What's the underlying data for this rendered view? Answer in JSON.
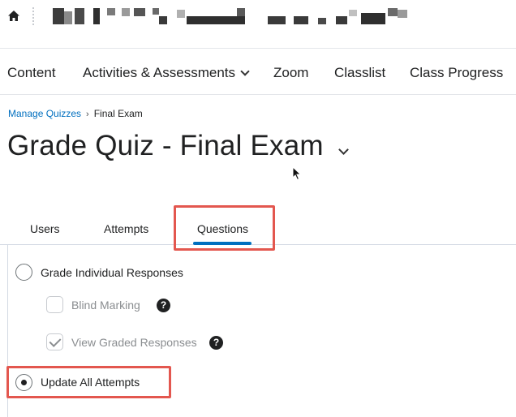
{
  "nav": {
    "items": [
      {
        "label": "Content"
      },
      {
        "label": "Activities & Assessments",
        "has_dropdown": true
      },
      {
        "label": "Zoom"
      },
      {
        "label": "Classlist"
      },
      {
        "label": "Class Progress"
      }
    ]
  },
  "breadcrumb": {
    "parent": "Manage Quizzes",
    "separator": "›",
    "current": "Final Exam"
  },
  "page": {
    "title": "Grade Quiz - Final Exam"
  },
  "tabs": [
    {
      "label": "Users",
      "active": false
    },
    {
      "label": "Attempts",
      "active": false
    },
    {
      "label": "Questions",
      "active": true
    }
  ],
  "options": {
    "grade_individual": {
      "label": "Grade Individual Responses",
      "selected": false
    },
    "blind_marking": {
      "label": "Blind Marking",
      "checked": false,
      "help": "?"
    },
    "view_graded": {
      "label": "View Graded Responses",
      "checked": true,
      "help": "?"
    },
    "update_all": {
      "label": "Update All Attempts",
      "selected": true
    }
  },
  "colors": {
    "link": "#006fbf",
    "highlight": "#e3574f",
    "tab_indicator": "#006fbf"
  },
  "icons": {
    "home": "home-icon",
    "cursor": "mouse-cursor-icon",
    "help": "help-icon"
  }
}
